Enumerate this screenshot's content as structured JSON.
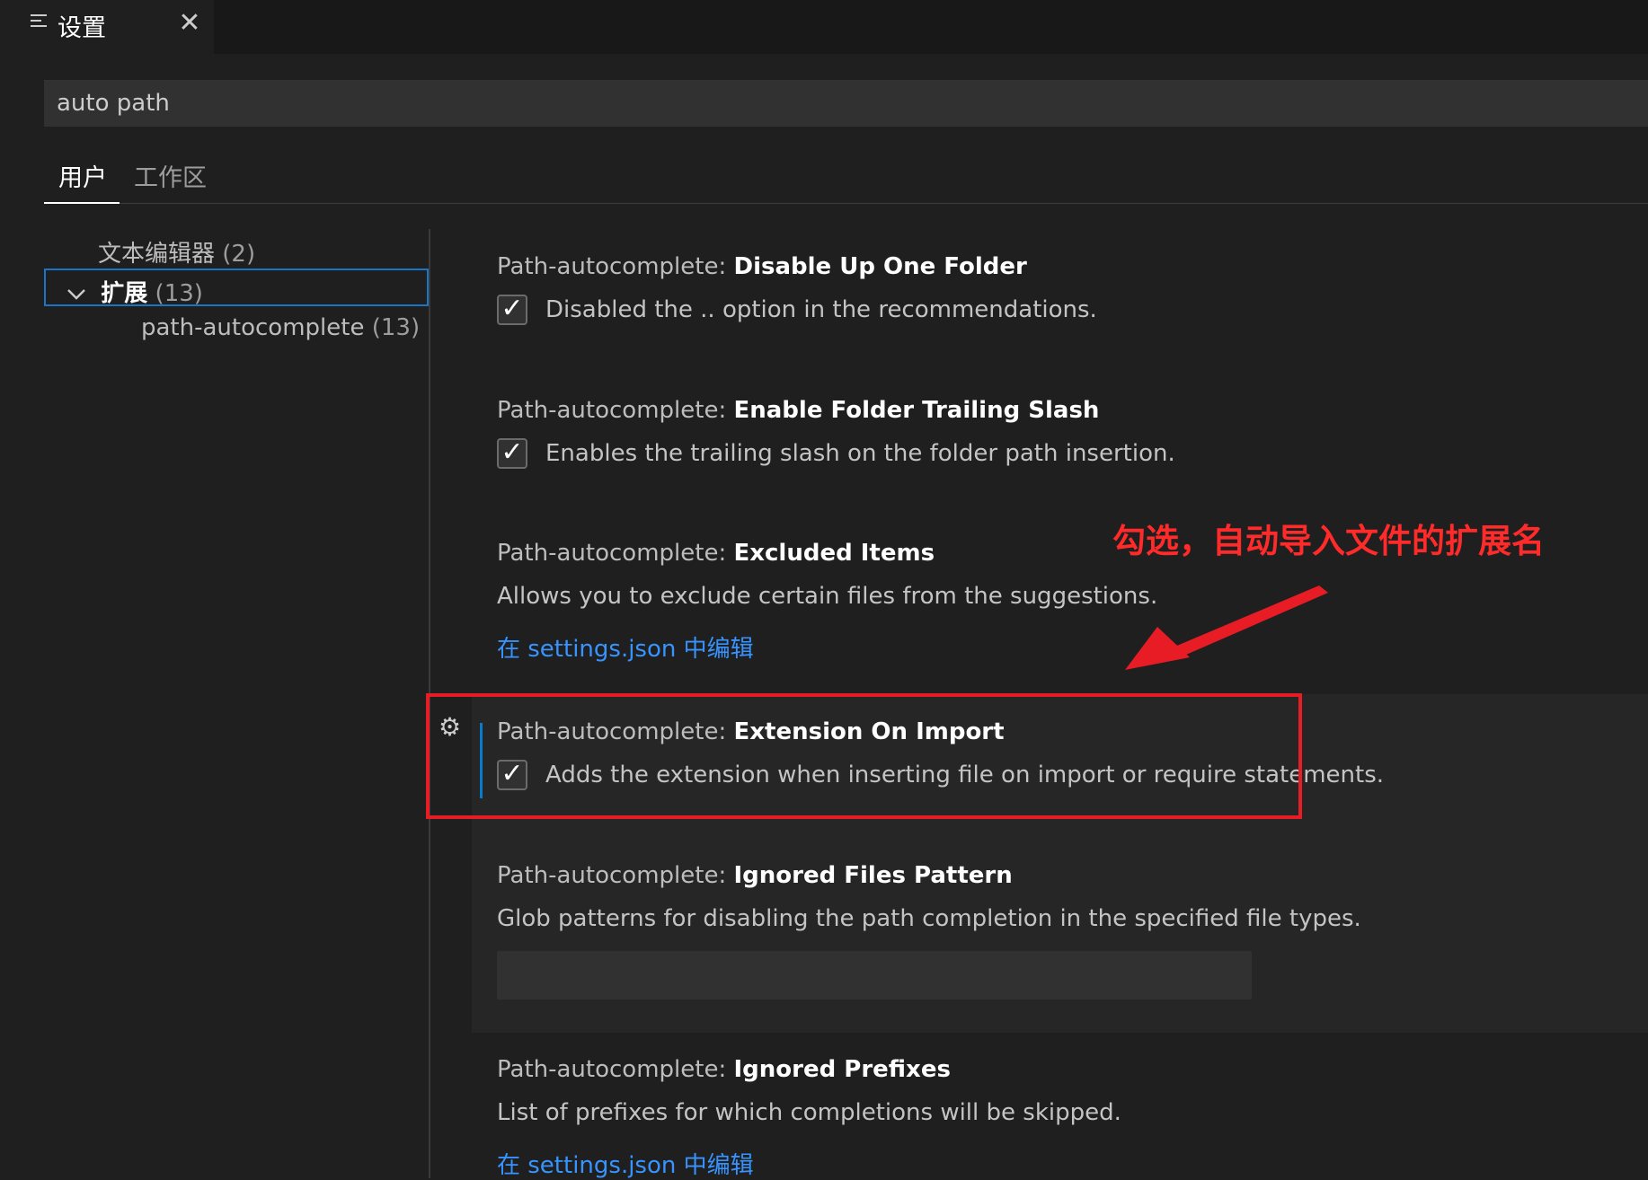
{
  "tab": {
    "title": "设置",
    "close_glyph": "✕",
    "icon": "settings-lines-icon"
  },
  "search": {
    "value": "auto path"
  },
  "scope_tabs": [
    {
      "label": "用户"
    },
    {
      "label": "工作区"
    }
  ],
  "toc": [
    {
      "label": "文本编辑器",
      "count": "(2)"
    },
    {
      "label": "扩展",
      "count": "(13)"
    },
    {
      "label": "path-autocomplete",
      "count": "(13)"
    }
  ],
  "settings": [
    {
      "prefix": "Path-autocomplete: ",
      "name": "Disable Up One Folder",
      "description": "Disabled the .. option in the recommendations.",
      "checked": true
    },
    {
      "prefix": "Path-autocomplete: ",
      "name": "Enable Folder Trailing Slash",
      "description": "Enables the trailing slash on the folder path insertion.",
      "checked": true
    },
    {
      "prefix": "Path-autocomplete: ",
      "name": "Excluded Items",
      "description": "Allows you to exclude certain files from the suggestions.",
      "link": "在 settings.json 中编辑"
    },
    {
      "prefix": "Path-autocomplete: ",
      "name": "Extension On Import",
      "description": "Adds the extension when inserting file on import or require statements.",
      "checked": true
    },
    {
      "prefix": "Path-autocomplete: ",
      "name": "Ignored Files Pattern",
      "description": "Glob patterns for disabling the path completion in the specified file types.",
      "input_value": ""
    },
    {
      "prefix": "Path-autocomplete: ",
      "name": "Ignored Prefixes",
      "description": "List of prefixes for which completions will be skipped.",
      "link": "在 settings.json 中编辑"
    }
  ],
  "annotation": {
    "text": "勾选，自动导入文件的扩展名",
    "color": "#e81c25"
  },
  "colors": {
    "accent": "#0a7acd",
    "link": "#3794ff",
    "background": "#1f1f1f"
  }
}
